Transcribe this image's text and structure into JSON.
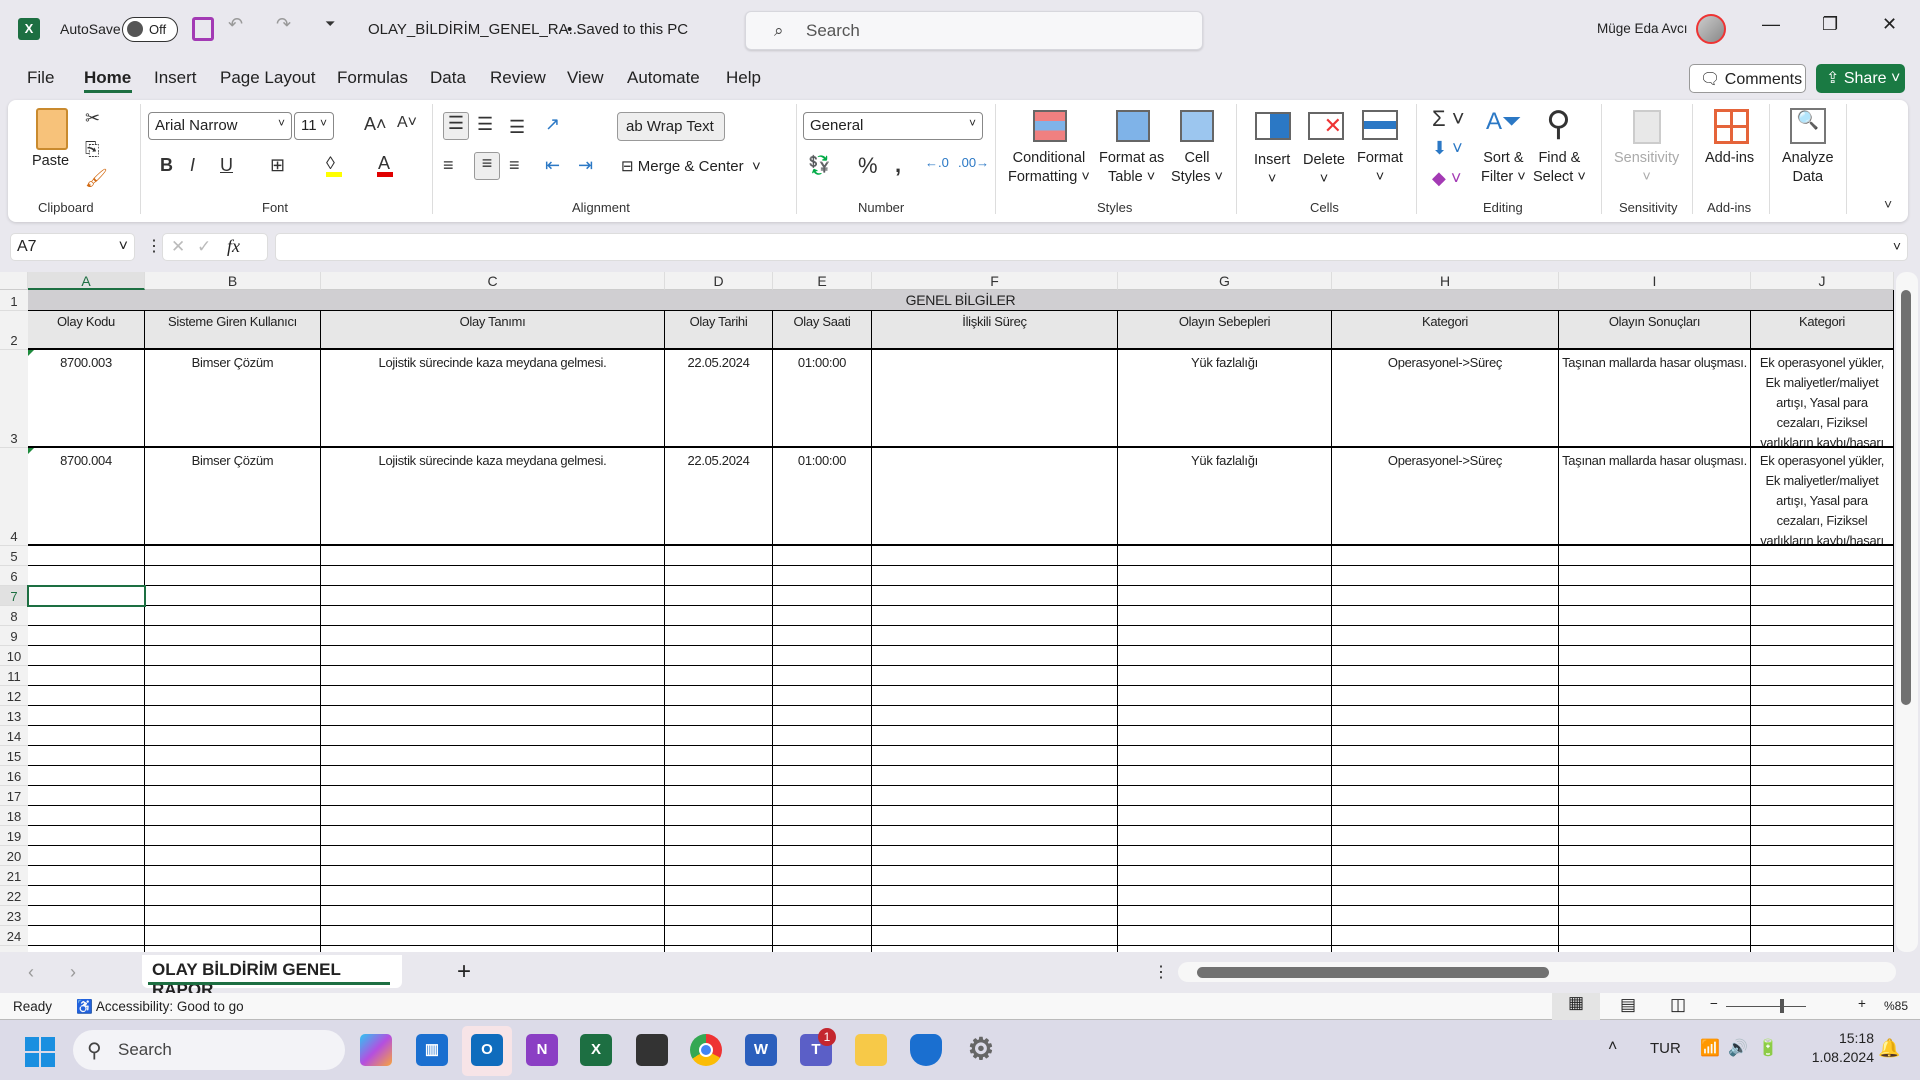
{
  "titlebar": {
    "app_icon": "excel-icon",
    "autosave_label": "AutoSave",
    "autosave_state": "Off",
    "filename": "OLAY_BİLDİRİM_GENEL_RA...",
    "save_status": "• Saved to this PC",
    "search_placeholder": "Search",
    "user_name": "Müge Eda Avcı"
  },
  "menu": {
    "tabs": [
      "File",
      "Home",
      "Insert",
      "Page Layout",
      "Formulas",
      "Data",
      "Review",
      "View",
      "Automate",
      "Help"
    ],
    "active": "Home",
    "comments": "Comments",
    "share": "Share"
  },
  "ribbon": {
    "clipboard": {
      "paste": "Paste",
      "label": "Clipboard"
    },
    "font": {
      "name": "Arial Narrow",
      "size": "11",
      "label": "Font",
      "fill_color": "#ffff00",
      "font_color": "#e00000"
    },
    "alignment": {
      "wrap": "Wrap Text",
      "merge": "Merge & Center",
      "label": "Alignment"
    },
    "number": {
      "format": "General",
      "label": "Number"
    },
    "styles": {
      "conditional": [
        "Conditional",
        "Formatting"
      ],
      "format_table": [
        "Format as",
        "Table"
      ],
      "cell_styles": [
        "Cell",
        "Styles"
      ],
      "label": "Styles"
    },
    "cells": {
      "insert": "Insert",
      "delete": "Delete",
      "format": "Format",
      "label": "Cells"
    },
    "editing": {
      "sort": [
        "Sort &",
        "Filter"
      ],
      "find": [
        "Find &",
        "Select"
      ],
      "label": "Editing"
    },
    "sensitivity": {
      "button": "Sensitivity",
      "label": "Sensitivity"
    },
    "addins": {
      "button": "Add-ins",
      "label": "Add-ins"
    },
    "analyze": [
      "Analyze",
      "Data"
    ]
  },
  "formula_bar": {
    "name_box": "A7",
    "fx": "fx",
    "value": ""
  },
  "sheet": {
    "columns": [
      "A",
      "B",
      "C",
      "D",
      "E",
      "F",
      "G",
      "H",
      "I",
      "J"
    ],
    "selected_cell": "A7",
    "title": "GENEL BİLGİLER",
    "headers": [
      "Olay Kodu",
      "Sisteme Giren Kullanıcı",
      "Olay Tanımı",
      "Olay Tarihi",
      "Olay Saati",
      "İlişkili Süreç",
      "Olayın Sebepleri",
      "Kategori",
      "Olayın Sonuçları",
      "Kategori"
    ],
    "rows": [
      [
        "8700.003",
        "Bimser Çözüm",
        "Lojistik sürecinde kaza meydana gelmesi.",
        "22.05.2024",
        "01:00:00",
        "",
        "Yük fazlalığı",
        "Operasyonel->Süreç",
        "Taşınan mallarda hasar oluşması.",
        "Ek operasyonel yükler, Ek maliyetler/maliyet artışı, Yasal para cezaları, Fiziksel varlıkların kaybı/hasarı"
      ],
      [
        "8700.004",
        "Bimser Çözüm",
        "Lojistik sürecinde kaza meydana gelmesi.",
        "22.05.2024",
        "01:00:00",
        "",
        "Yük fazlalığı",
        "Operasyonel->Süreç",
        "Taşınan mallarda hasar oluşması.",
        "Ek operasyonel yükler, Ek maliyetler/maliyet artışı, Yasal para cezaları, Fiziksel varlıkların kaybı/hasarı"
      ]
    ],
    "row_numbers": [
      "1",
      "2",
      "3",
      "4",
      "5",
      "6",
      "7",
      "8",
      "9",
      "10",
      "11",
      "12",
      "13",
      "14",
      "15",
      "16",
      "17",
      "18",
      "19",
      "20",
      "21",
      "22",
      "23",
      "24"
    ],
    "tab": "OLAY BİLDİRİM GENEL RAPOR"
  },
  "status": {
    "ready": "Ready",
    "accessibility": "Accessibility: Good to go",
    "zoom": "%85"
  },
  "taskbar": {
    "search": "Search",
    "language": "TUR",
    "time": "15:18",
    "date": "1.08.2024",
    "teams_badge": "1"
  }
}
